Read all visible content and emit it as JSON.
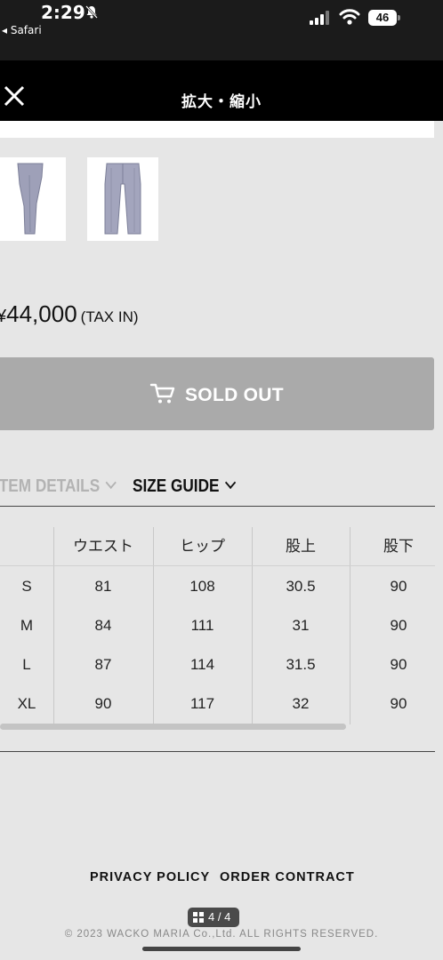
{
  "status_bar": {
    "time": "2:29",
    "back_app": "◂ Safari",
    "battery": "46"
  },
  "header": {
    "title": "拡大・縮小"
  },
  "product": {
    "currency_symbol": "¥",
    "price": "44,000",
    "tax_note": "(TAX IN)",
    "sold_out_label": "SOLD OUT"
  },
  "tabs": {
    "item_details": "ITEM DETAILS",
    "size_guide": "SIZE GUIDE"
  },
  "size_table": {
    "columns": [
      "",
      "ウエスト",
      "ヒップ",
      "股上",
      "股下"
    ],
    "rows": [
      [
        "S",
        "81",
        "108",
        "30.5",
        "90"
      ],
      [
        "M",
        "84",
        "111",
        "31",
        "90"
      ],
      [
        "L",
        "87",
        "114",
        "31.5",
        "90"
      ],
      [
        "XL",
        "90",
        "117",
        "32",
        "90"
      ]
    ]
  },
  "footer": {
    "privacy_policy": "PRIVACY POLICY",
    "order_contract": "ORDER CONTRACT",
    "pager": "4 / 4",
    "copyright": "© 2023 WACKO MARIA Co.,Ltd. ALL RIGHTS RESERVED."
  },
  "colors": {
    "header_bg": "#000000",
    "sold_out_bg": "#aaaaaa",
    "page_bg": "#e6e6e6"
  }
}
